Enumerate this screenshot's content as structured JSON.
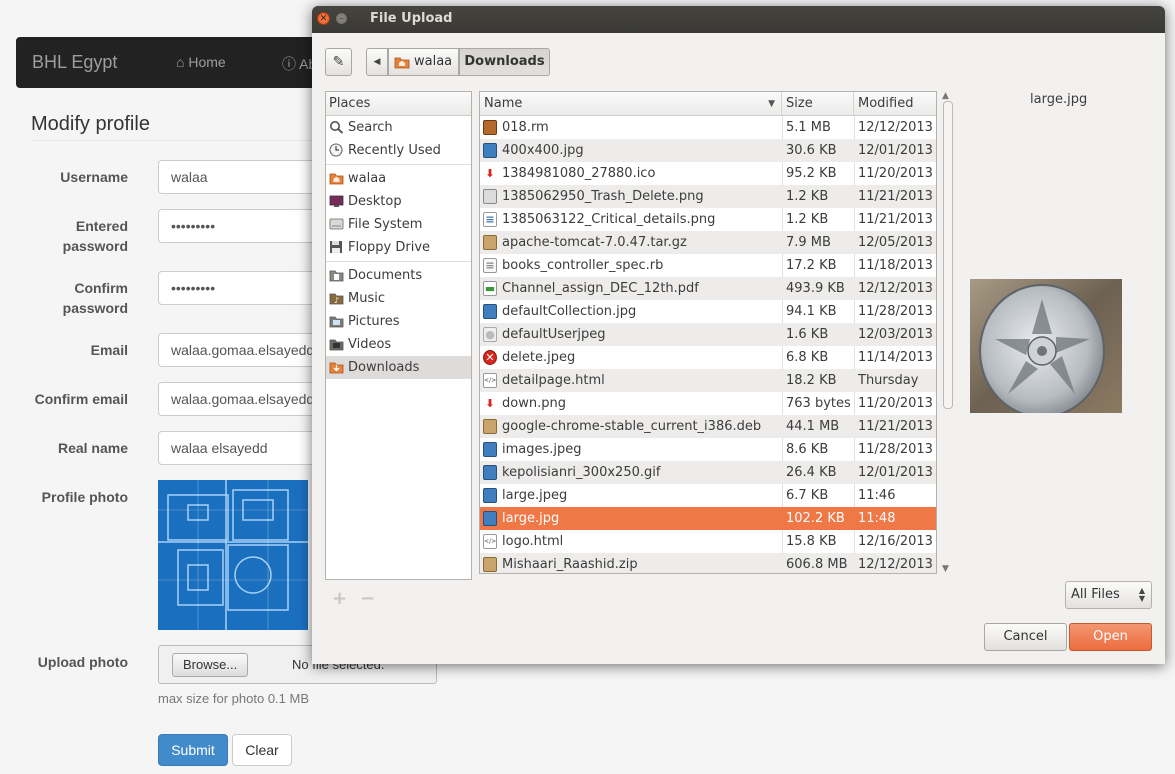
{
  "navbar": {
    "brand": "BHL Egypt",
    "home": "Home",
    "about": "Ab"
  },
  "form": {
    "heading": "Modify profile",
    "username": {
      "label": "Username",
      "value": "walaa"
    },
    "entered_password": {
      "label": "Entered password",
      "value": "•••••••••"
    },
    "confirm_password": {
      "label": "Confirm password",
      "value": "•••••••••"
    },
    "email": {
      "label": "Email",
      "value": "walaa.gomaa.elsayedd"
    },
    "confirm_email": {
      "label": "Confirm email",
      "value": "walaa.gomaa.elsayedd"
    },
    "real_name": {
      "label": "Real name",
      "value": "walaa elsayedd"
    },
    "profile_photo_label": "Profile photo",
    "upload_photo": {
      "label": "Upload photo",
      "browse": "Browse...",
      "status": "No file selected."
    },
    "help_text": "max size for photo 0.1 MB",
    "submit": "Submit",
    "clear": "Clear"
  },
  "dialog": {
    "title": "File Upload",
    "path": [
      "walaa",
      "Downloads"
    ],
    "places_header": "Places",
    "places": [
      {
        "label": "Search",
        "icon": "search-icon"
      },
      {
        "label": "Recently Used",
        "icon": "clock-icon"
      },
      {
        "label": "walaa",
        "icon": "home-folder-icon"
      },
      {
        "label": "Desktop",
        "icon": "desktop-icon"
      },
      {
        "label": "File System",
        "icon": "filesystem-icon"
      },
      {
        "label": "Floppy Drive",
        "icon": "floppy-icon"
      },
      {
        "label": "Documents",
        "icon": "documents-icon"
      },
      {
        "label": "Music",
        "icon": "music-icon"
      },
      {
        "label": "Pictures",
        "icon": "pictures-icon"
      },
      {
        "label": "Videos",
        "icon": "videos-icon"
      },
      {
        "label": "Downloads",
        "icon": "downloads-icon",
        "selected": true
      }
    ],
    "columns": {
      "name": "Name",
      "size": "Size",
      "modified": "Modified"
    },
    "files": [
      {
        "name": "018.rm",
        "size": "5.1 MB",
        "modified": "12/12/2013",
        "icon": "video-file-icon"
      },
      {
        "name": "400x400.jpg",
        "size": "30.6 KB",
        "modified": "12/01/2013",
        "icon": "image-file-icon"
      },
      {
        "name": "1384981080_27880.ico",
        "size": "95.2 KB",
        "modified": "11/20/2013",
        "icon": "download-arrow-icon"
      },
      {
        "name": "1385062950_Trash_Delete.png",
        "size": "1.2 KB",
        "modified": "11/21/2013",
        "icon": "trash-image-icon"
      },
      {
        "name": "1385063122_Critical_details.png",
        "size": "1.2 KB",
        "modified": "11/21/2013",
        "icon": "document-image-icon"
      },
      {
        "name": "apache-tomcat-7.0.47.tar.gz",
        "size": "7.9 MB",
        "modified": "12/05/2013",
        "icon": "archive-icon"
      },
      {
        "name": "books_controller_spec.rb",
        "size": "17.2 KB",
        "modified": "11/18/2013",
        "icon": "text-file-icon"
      },
      {
        "name": "Channel_assign_DEC_12th.pdf",
        "size": "493.9 KB",
        "modified": "12/12/2013",
        "icon": "pdf-file-icon"
      },
      {
        "name": "defaultCollection.jpg",
        "size": "94.1 KB",
        "modified": "11/28/2013",
        "icon": "image-file-icon"
      },
      {
        "name": "defaultUserjpeg",
        "size": "1.6 KB",
        "modified": "12/03/2013",
        "icon": "user-image-icon"
      },
      {
        "name": "delete.jpeg",
        "size": "6.8 KB",
        "modified": "11/14/2013",
        "icon": "delete-image-icon"
      },
      {
        "name": "detailpage.html",
        "size": "18.2 KB",
        "modified": "Thursday",
        "icon": "html-file-icon"
      },
      {
        "name": "down.png",
        "size": "763 bytes",
        "modified": "11/20/2013",
        "icon": "download-arrow-icon"
      },
      {
        "name": "google-chrome-stable_current_i386.deb",
        "size": "44.1 MB",
        "modified": "11/21/2013",
        "icon": "archive-icon"
      },
      {
        "name": "images.jpeg",
        "size": "8.6 KB",
        "modified": "11/28/2013",
        "icon": "image-file-icon"
      },
      {
        "name": "kepolisianri_300x250.gif",
        "size": "26.4 KB",
        "modified": "12/01/2013",
        "icon": "image-file-icon"
      },
      {
        "name": "large.jpeg",
        "size": "6.7 KB",
        "modified": "11:46",
        "icon": "image-file-icon"
      },
      {
        "name": "large.jpg",
        "size": "102.2 KB",
        "modified": "11:48",
        "icon": "image-file-icon",
        "selected": true
      },
      {
        "name": "logo.html",
        "size": "15.8 KB",
        "modified": "12/16/2013",
        "icon": "html-file-icon"
      },
      {
        "name": "Mishaari_Raashid.zip",
        "size": "606.8 MB",
        "modified": "12/12/2013",
        "icon": "archive-icon"
      }
    ],
    "preview_name": "large.jpg",
    "filter": "All Files",
    "cancel": "Cancel",
    "open": "Open"
  }
}
